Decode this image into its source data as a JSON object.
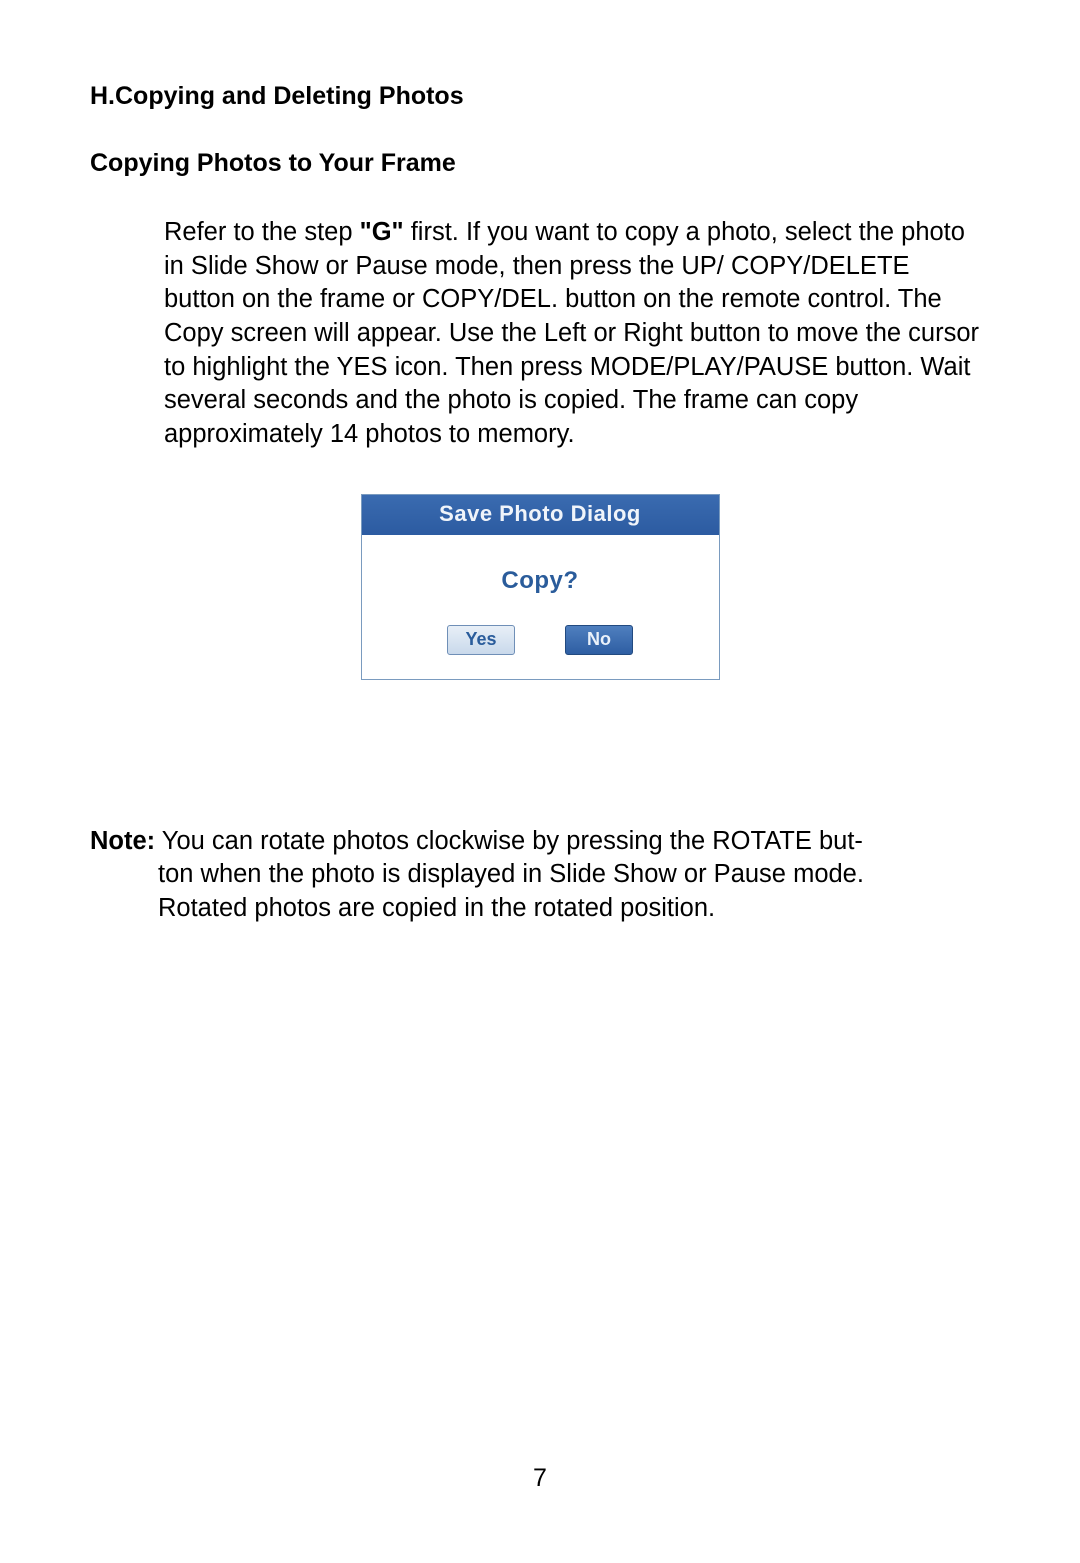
{
  "headings": {
    "section": "H.Copying and Deleting Photos",
    "subsection": "Copying Photos to Your Frame"
  },
  "paragraph": {
    "pre": "Refer to  the step ",
    "g": "\"G\"",
    "post": " first. If you want to copy a photo, select the photo in Slide Show or Pause mode, then press the UP/ COPY/DELETE button on the frame or COPY/DEL. button on the remote control. The Copy screen will appear. Use the Left or Right button to move the cursor to highlight the YES icon. Then press MODE/PLAY/PAUSE button. Wait several seconds and  the photo is copied. The frame can copy approximately 14 photos to memory."
  },
  "dialog": {
    "title": "Save Photo Dialog",
    "prompt": "Copy?",
    "yes": "Yes",
    "no": "No"
  },
  "note": {
    "label": "Note:",
    "line1_rest": " You can rotate photos clockwise by pressing the ROTATE but-",
    "line2": "ton when the photo is displayed in Slide Show or Pause mode.",
    "line3": "Rotated  photos are copied in the rotated position."
  },
  "page_number": "7"
}
